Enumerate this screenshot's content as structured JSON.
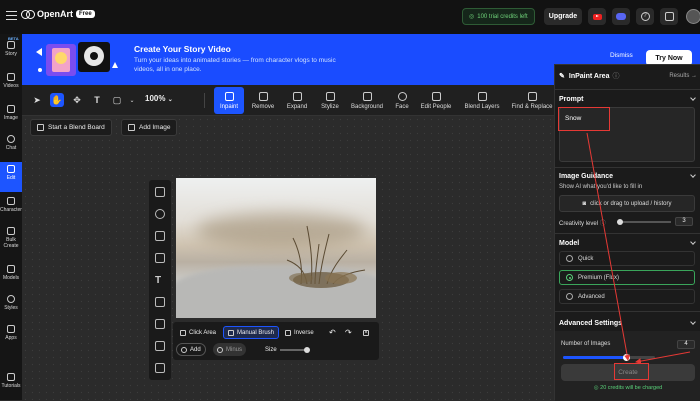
{
  "header": {
    "brand": "OpenArt",
    "plan_badge": "Free",
    "credits_text": "100 trial credits left",
    "upgrade_label": "Upgrade"
  },
  "sidebar": {
    "beta_badge": "BETA",
    "items": [
      {
        "label": "Story"
      },
      {
        "label": "Videos"
      },
      {
        "label": "Image"
      },
      {
        "label": "Chat"
      },
      {
        "label": "Edit"
      },
      {
        "label": "Character"
      },
      {
        "label": "Bulk Create"
      },
      {
        "label": "Models"
      },
      {
        "label": "Styles"
      },
      {
        "label": "Apps"
      },
      {
        "label": "Tutorials"
      }
    ]
  },
  "banner": {
    "title": "Create Your Story Video",
    "subtitle": "Turn your ideas into animated stories — from character vlogs to music videos, all in one place.",
    "dismiss_label": "Dismiss",
    "try_label": "Try Now"
  },
  "toolbar": {
    "zoom": "100%",
    "tools": [
      "Inpaint",
      "Remove",
      "Expand",
      "Stylize",
      "Background",
      "Face",
      "Edit People",
      "Blend Layers",
      "Find & Replace"
    ]
  },
  "canvas": {
    "blend_board_label": "Start a Blend Board",
    "add_image_label": "Add Image"
  },
  "mask_bar": {
    "click_area": "Click Area",
    "manual_brush": "Manual Brush",
    "inverse": "Inverse",
    "add": "Add",
    "minus": "Minus",
    "size": "Size"
  },
  "panel": {
    "title": "InPaint Area",
    "results_label": "Results",
    "prompt_section": "Prompt",
    "prompt_value": "Snow",
    "guidance_section": "Image Guidance",
    "guidance_hint": "Show AI what you'd like to fill in",
    "upload_label": "click or drag to upload / history",
    "creativity_label": "Creativity level",
    "creativity_value": "3",
    "model_section": "Model",
    "models": [
      "Quick",
      "Premium (Flux)",
      "Advanced"
    ],
    "advanced_section": "Advanced Settings",
    "num_images_label": "Number of Images",
    "num_images_value": "4",
    "num_images_fraction": 0.68,
    "create_label": "Create",
    "charge_note": "20 credits will be charged"
  },
  "colors": {
    "accent": "#1d55ff",
    "annotation": "#e53935",
    "success": "#5ad27a"
  }
}
